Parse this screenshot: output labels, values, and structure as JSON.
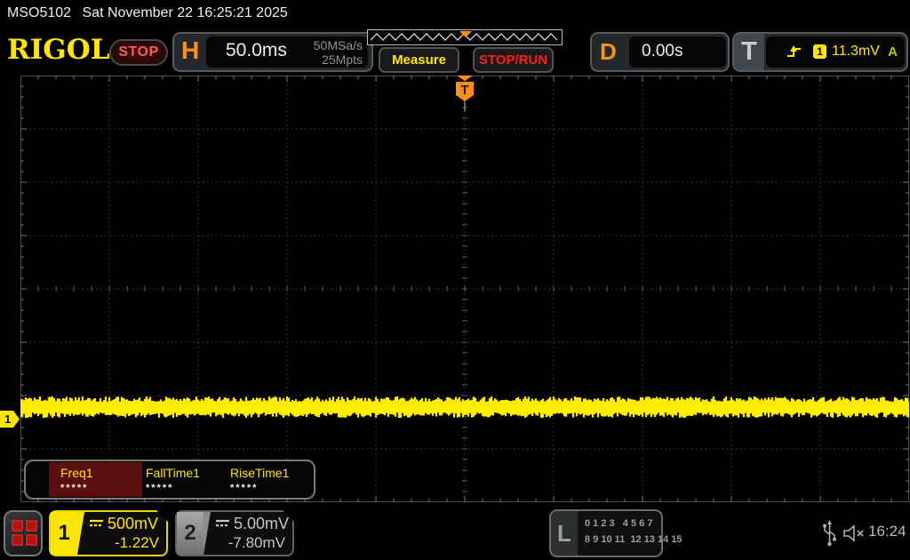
{
  "titlebar": {
    "model": "MSO5102",
    "datetime": "Sat November 22 16:25:21 2025"
  },
  "header": {
    "logo": "RIGOL",
    "run_state": "STOP",
    "horizontal": {
      "label": "H",
      "timebase": "50.0ms",
      "sample_rate": "50MSa/s",
      "mem_depth": "25Mpts"
    },
    "measure_button": "Measure",
    "stoprun_button": "STOP/RUN",
    "delay": {
      "label": "D",
      "value": "0.00s"
    },
    "trigger": {
      "label": "T",
      "source_channel": "1",
      "level": "11.3mV",
      "sweep_mode": "A",
      "marker": "T"
    }
  },
  "measurements": {
    "items": [
      {
        "label": "Freq1",
        "value": "*****",
        "selected": true
      },
      {
        "label": "FallTime1",
        "value": "*****",
        "selected": false
      },
      {
        "label": "RiseTime1",
        "value": "*****",
        "selected": false
      }
    ]
  },
  "channels": [
    {
      "id": "1",
      "scale": "500mV",
      "offset": "-1.22V",
      "coupling": "DC"
    },
    {
      "id": "2",
      "scale": "5.00mV",
      "offset": "-7.80mV",
      "coupling": "DC"
    }
  ],
  "logic": {
    "label": "L",
    "row1": "0 1 2 3   4 5 6 7",
    "row2": "8 9 10 11  12 13 14 15"
  },
  "status": {
    "time": "16:24"
  },
  "colors": {
    "waveform": "#ffec00",
    "channel1": "#ffe600",
    "channel2": "#c2c6c8",
    "accent_orange": "#ff9015",
    "grid_line": "#3f3f3f",
    "grid_tick": "#787878",
    "preview_trace": "#e8e8e8"
  }
}
